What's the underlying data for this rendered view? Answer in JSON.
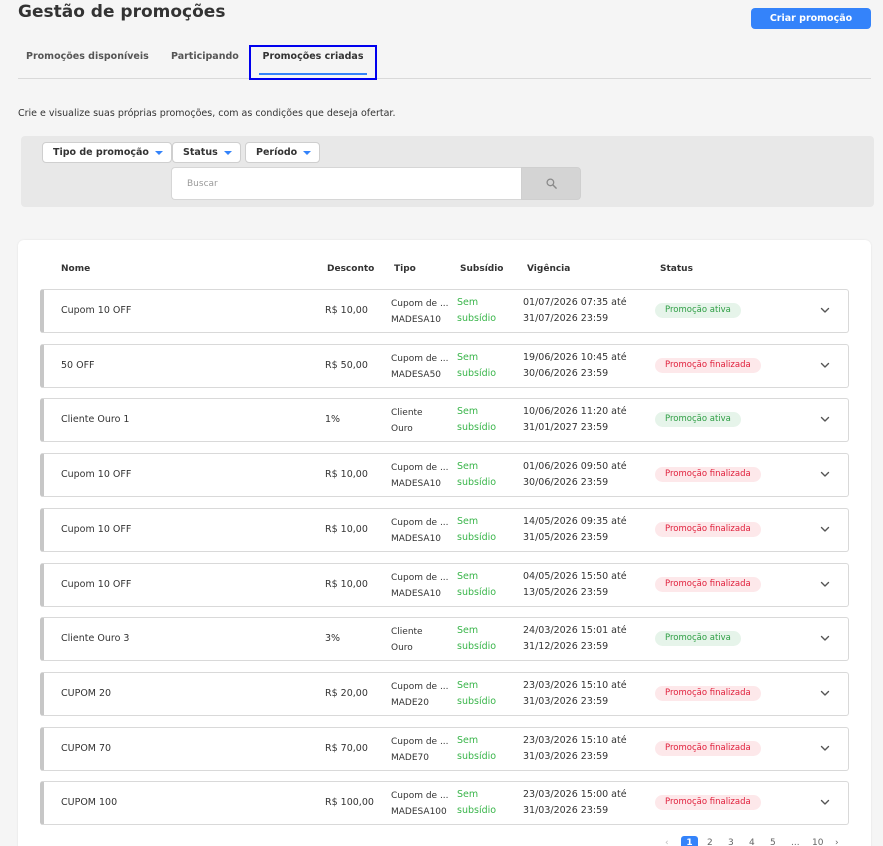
{
  "header": {
    "title": "Gestão de promoções",
    "create_button": "Criar promoção"
  },
  "tabs": [
    {
      "label": "Promoções disponíveis"
    },
    {
      "label": "Participando"
    },
    {
      "label": "Promoções criadas",
      "selected": true
    }
  ],
  "subtitle": "Crie e visualize suas próprias promoções, com as condições que deseja ofertar.",
  "filters": {
    "type_label": "Tipo de promoção",
    "status_label": "Status",
    "period_label": "Período",
    "search_placeholder": "Buscar"
  },
  "table": {
    "headers": {
      "name": "Nome",
      "discount": "Desconto",
      "type": "Tipo",
      "subsidy": "Subsídio",
      "validity": "Vigência",
      "status": "Status"
    },
    "rows": [
      {
        "name": "Cupom 10 OFF",
        "discount": "R$ 10,00",
        "type1": "Cupom de ...",
        "type2": "MADESA10",
        "sub1": "Sem",
        "sub2": "subsídio",
        "vig1": "01/07/2026 07:35 até",
        "vig2": "31/07/2026 23:59",
        "status": "Promoção ativa",
        "state": "active"
      },
      {
        "name": "50 OFF",
        "discount": "R$ 50,00",
        "type1": "Cupom de ...",
        "type2": "MADESA50",
        "sub1": "Sem",
        "sub2": "subsídio",
        "vig1": "19/06/2026 10:45 até",
        "vig2": "30/06/2026 23:59",
        "status": "Promoção finalizada",
        "state": "finished"
      },
      {
        "name": "Cliente Ouro 1",
        "discount": "1%",
        "type1": "Cliente",
        "type2": "Ouro",
        "sub1": "Sem",
        "sub2": "subsídio",
        "vig1": "10/06/2026 11:20 até",
        "vig2": "31/01/2027 23:59",
        "status": "Promoção ativa",
        "state": "active"
      },
      {
        "name": "Cupom 10 OFF",
        "discount": "R$ 10,00",
        "type1": "Cupom de ...",
        "type2": "MADESA10",
        "sub1": "Sem",
        "sub2": "subsídio",
        "vig1": "01/06/2026 09:50 até",
        "vig2": "30/06/2026 23:59",
        "status": "Promoção finalizada",
        "state": "finished"
      },
      {
        "name": "Cupom 10 OFF",
        "discount": "R$ 10,00",
        "type1": "Cupom de ...",
        "type2": "MADESA10",
        "sub1": "Sem",
        "sub2": "subsídio",
        "vig1": "14/05/2026 09:35 até",
        "vig2": "31/05/2026 23:59",
        "status": "Promoção finalizada",
        "state": "finished"
      },
      {
        "name": "Cupom 10 OFF",
        "discount": "R$ 10,00",
        "type1": "Cupom de ...",
        "type2": "MADESA10",
        "sub1": "Sem",
        "sub2": "subsídio",
        "vig1": "04/05/2026 15:50 até",
        "vig2": "13/05/2026 23:59",
        "status": "Promoção finalizada",
        "state": "finished"
      },
      {
        "name": "Cliente Ouro 3",
        "discount": "3%",
        "type1": "Cliente",
        "type2": "Ouro",
        "sub1": "Sem",
        "sub2": "subsídio",
        "vig1": "24/03/2026 15:01 até",
        "vig2": "31/12/2026 23:59",
        "status": "Promoção ativa",
        "state": "active"
      },
      {
        "name": "CUPOM 20",
        "discount": "R$ 20,00",
        "type1": "Cupom de ...",
        "type2": "MADE20",
        "sub1": "Sem",
        "sub2": "subsídio",
        "vig1": "23/03/2026 15:10 até",
        "vig2": "31/03/2026 23:59",
        "status": "Promoção finalizada",
        "state": "finished"
      },
      {
        "name": "CUPOM 70",
        "discount": "R$ 70,00",
        "type1": "Cupom de ...",
        "type2": "MADE70",
        "sub1": "Sem",
        "sub2": "subsídio",
        "vig1": "23/03/2026 15:10 até",
        "vig2": "31/03/2026 23:59",
        "status": "Promoção finalizada",
        "state": "finished"
      },
      {
        "name": "CUPOM 100",
        "discount": "R$ 100,00",
        "type1": "Cupom de ...",
        "type2": "MADESA100",
        "sub1": "Sem",
        "sub2": "subsídio",
        "vig1": "23/03/2026 15:00 até",
        "vig2": "31/03/2026 23:59",
        "status": "Promoção finalizada",
        "state": "finished"
      }
    ]
  },
  "pagination": {
    "prev": "‹",
    "pages": [
      "1",
      "2",
      "3",
      "4",
      "5"
    ],
    "ellipsis": "...",
    "last": "10",
    "next": "›",
    "current": "1"
  },
  "colors": {
    "primary": "#3483fa",
    "active_text": "#2e9e44",
    "finished_text": "#e0203c",
    "subsidy_text": "#39b54a"
  },
  "icons": {
    "search": "magnifier-icon",
    "expand": "chevron-down-icon",
    "dropdown": "caret-down-icon"
  }
}
